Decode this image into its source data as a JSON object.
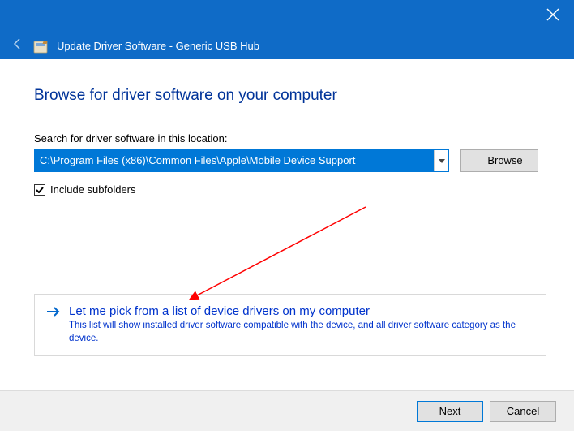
{
  "header": {
    "title": "Update Driver Software - Generic USB Hub"
  },
  "page": {
    "title": "Browse for driver software on your computer",
    "search_label": "Search for driver software in this location:",
    "path_value": "C:\\Program Files (x86)\\Common Files\\Apple\\Mobile Device Support",
    "browse_label": "Browse",
    "include_subfolders_label": "Include subfolders"
  },
  "option": {
    "title": "Let me pick from a list of device drivers on my computer",
    "desc": "This list will show installed driver software compatible with the device, and all driver software category as the device."
  },
  "footer": {
    "next_prefix": "N",
    "next_rest": "ext",
    "cancel": "Cancel"
  }
}
